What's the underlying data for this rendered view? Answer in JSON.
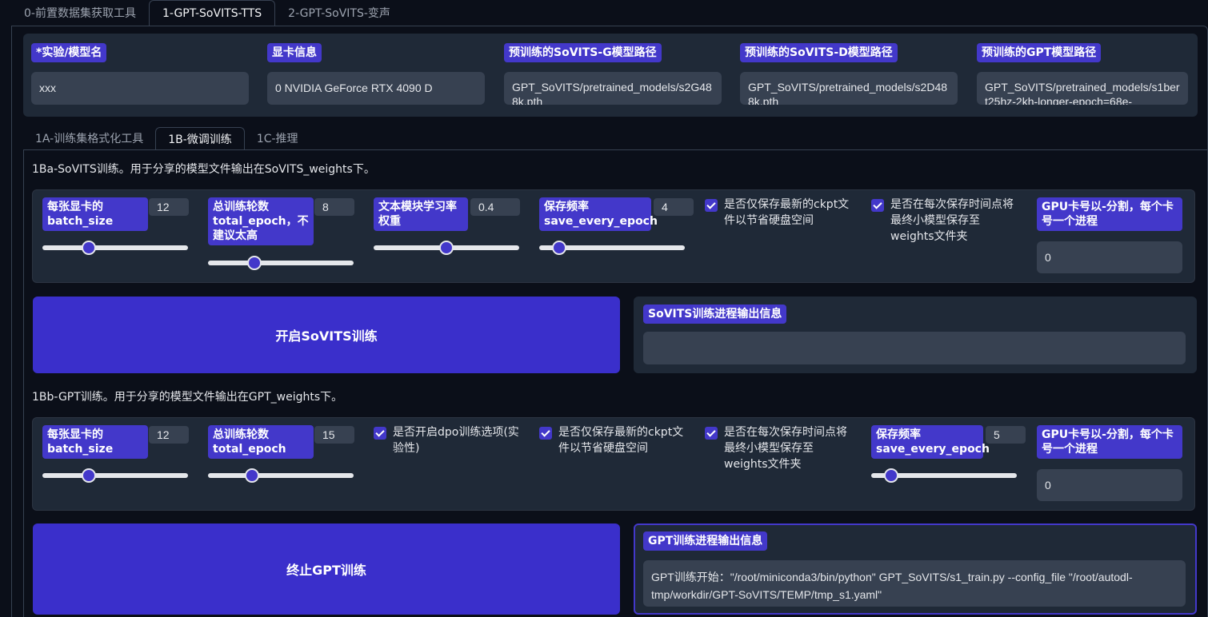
{
  "top_tabs": [
    {
      "label": "0-前置数据集获取工具"
    },
    {
      "label": "1-GPT-SoVITS-TTS"
    },
    {
      "label": "2-GPT-SoVITS-变声"
    }
  ],
  "model": {
    "exp_name_label": "*实验/模型名",
    "exp_name_value": "xxx",
    "gpu_info_label": "显卡信息",
    "gpu_info_value": "0  NVIDIA GeForce RTX 4090 D",
    "sovits_g_label": "预训练的SoVITS-G模型路径",
    "sovits_g_value": "GPT_SoVITS/pretrained_models/s2G488k.pth",
    "sovits_d_label": "预训练的SoVITS-D模型路径",
    "sovits_d_value": "GPT_SoVITS/pretrained_models/s2D488k.pth",
    "gpt_label": "预训练的GPT模型路径",
    "gpt_value": "GPT_SoVITS/pretrained_models/s1bert25hz-2kh-longer-epoch=68e-"
  },
  "sub_tabs": [
    {
      "label": "1A-训练集格式化工具"
    },
    {
      "label": "1B-微调训练"
    },
    {
      "label": "1C-推理"
    }
  ],
  "sovits": {
    "title": "1Ba-SoVITS训练。用于分享的模型文件输出在SoVITS_weights下。",
    "batch_label": "每张显卡的batch_size",
    "batch_value": "12",
    "batch_level": 0.3,
    "epoch_label": "总训练轮数total_epoch，不建议太高",
    "epoch_value": "8",
    "epoch_level": 0.3,
    "text_lr_label": "文本模块学习率权重",
    "text_lr_value": "0.4",
    "text_lr_level": 0.5,
    "save_freq_label": "保存频率save_every_epoch",
    "save_freq_value": "4",
    "save_freq_level": 0.1,
    "check_latest": "是否仅保存最新的ckpt文件以节省硬盘空间",
    "check_weights": "是否在每次保存时间点将最终小模型保存至weights文件夹",
    "gpu_label": "GPU卡号以-分割，每个卡号一个进程",
    "gpu_value": "0",
    "start_button": "开启SoVITS训练",
    "output_label": "SoVITS训练进程输出信息",
    "output_value": ""
  },
  "gpt": {
    "title": "1Bb-GPT训练。用于分享的模型文件输出在GPT_weights下。",
    "batch_label": "每张显卡的batch_size",
    "batch_value": "12",
    "batch_level": 0.3,
    "epoch_label": "总训练轮数total_epoch",
    "epoch_value": "15",
    "epoch_level": 0.28,
    "check_dpo": "是否开启dpo训练选项(实验性)",
    "check_latest": "是否仅保存最新的ckpt文件以节省硬盘空间",
    "check_weights": "是否在每次保存时间点将最终小模型保存至weights文件夹",
    "save_freq_label": "保存频率save_every_epoch",
    "save_freq_value": "5",
    "save_freq_level": 0.1,
    "gpu_label": "GPU卡号以-分割，每个卡号一个进程",
    "gpu_value": "0",
    "stop_button": "终止GPT训练",
    "output_label": "GPT训练进程输出信息",
    "output_value": "GPT训练开始：\"/root/miniconda3/bin/python\" GPT_SoVITS/s1_train.py --config_file \"/root/autodl-tmp/workdir/GPT-SoVITS/TEMP/tmp_s1.yaml\""
  },
  "colors": {
    "accent": "#4338ca",
    "button": "#3a2fcb",
    "panel": "#1f2937",
    "input": "#374151",
    "background": "#0b0f19"
  }
}
